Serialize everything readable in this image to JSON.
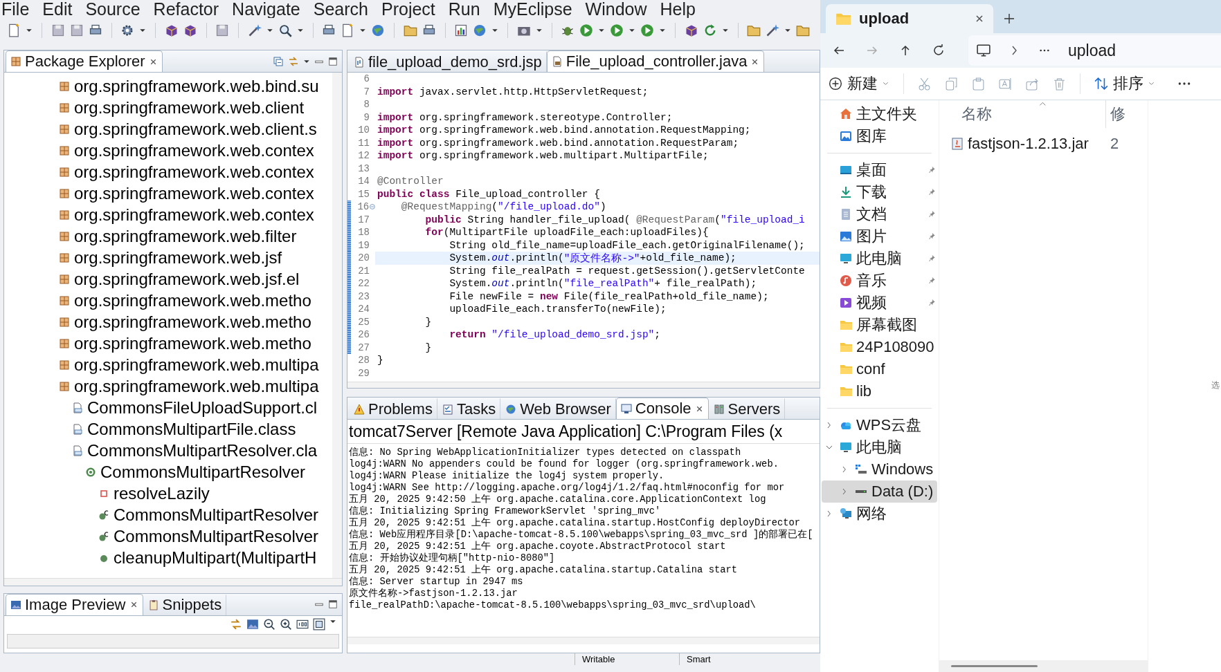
{
  "menu": [
    "File",
    "Edit",
    "Source",
    "Refactor",
    "Navigate",
    "Search",
    "Project",
    "Run",
    "MyEclipse",
    "Window",
    "Help"
  ],
  "package_explorer": {
    "tabs": [
      {
        "label": "Package Explorer",
        "selected": true
      }
    ],
    "tree": [
      {
        "label": "org.springframework.web.bind.su",
        "kind": "package"
      },
      {
        "label": "org.springframework.web.client",
        "kind": "package"
      },
      {
        "label": "org.springframework.web.client.s",
        "kind": "package"
      },
      {
        "label": "org.springframework.web.contex",
        "kind": "package"
      },
      {
        "label": "org.springframework.web.contex",
        "kind": "package"
      },
      {
        "label": "org.springframework.web.contex",
        "kind": "package"
      },
      {
        "label": "org.springframework.web.contex",
        "kind": "package"
      },
      {
        "label": "org.springframework.web.filter",
        "kind": "package"
      },
      {
        "label": "org.springframework.web.jsf",
        "kind": "package"
      },
      {
        "label": "org.springframework.web.jsf.el",
        "kind": "package"
      },
      {
        "label": "org.springframework.web.metho",
        "kind": "package"
      },
      {
        "label": "org.springframework.web.metho",
        "kind": "package"
      },
      {
        "label": "org.springframework.web.metho",
        "kind": "package"
      },
      {
        "label": "org.springframework.web.multipa",
        "kind": "package"
      },
      {
        "label": "org.springframework.web.multipa",
        "kind": "package",
        "children": [
          {
            "label": "CommonsFileUploadSupport.cl",
            "kind": "classfile"
          },
          {
            "label": "CommonsMultipartFile.class",
            "kind": "classfile"
          },
          {
            "label": "CommonsMultipartResolver.cla",
            "kind": "classfile",
            "children": [
              {
                "label": "CommonsMultipartResolver",
                "kind": "class",
                "children": [
                  {
                    "label": "resolveLazily",
                    "kind": "field"
                  },
                  {
                    "label": "CommonsMultipartResolver",
                    "kind": "constructor"
                  },
                  {
                    "label": "CommonsMultipartResolver",
                    "kind": "constructor"
                  },
                  {
                    "label": "cleanupMultipart(MultipartH",
                    "kind": "method"
                  }
                ]
              }
            ]
          }
        ]
      }
    ]
  },
  "editor": {
    "tabs": [
      {
        "label": "file_upload_demo_srd.jsp",
        "kind": "jsp",
        "selected": false
      },
      {
        "label": "File_upload_controller.java",
        "kind": "java",
        "selected": true
      }
    ],
    "lines": [
      {
        "number": "6",
        "highlighted": false,
        "changed": false,
        "collapsible": false
      },
      {
        "number": "7",
        "highlighted": false,
        "changed": false,
        "collapsible": false,
        "segments": [
          {
            "kind": "keyword",
            "text": "import"
          },
          {
            "kind": "plain",
            "text": " javax.servlet.http.HttpServletRequest;"
          }
        ]
      },
      {
        "number": "8",
        "highlighted": false,
        "changed": false,
        "collapsible": false
      },
      {
        "number": "9",
        "highlighted": false,
        "changed": false,
        "collapsible": false,
        "segments": [
          {
            "kind": "keyword",
            "text": "import"
          },
          {
            "kind": "plain",
            "text": " org.springframework.stereotype.Controller;"
          }
        ]
      },
      {
        "number": "10",
        "highlighted": false,
        "changed": false,
        "collapsible": false,
        "segments": [
          {
            "kind": "keyword",
            "text": "import"
          },
          {
            "kind": "plain",
            "text": " org.springframework.web.bind.annotation.RequestMapping;"
          }
        ]
      },
      {
        "number": "11",
        "highlighted": false,
        "changed": false,
        "collapsible": false,
        "segments": [
          {
            "kind": "keyword",
            "text": "import"
          },
          {
            "kind": "plain",
            "text": " org.springframework.web.bind.annotation.RequestParam;"
          }
        ]
      },
      {
        "number": "12",
        "highlighted": false,
        "changed": false,
        "collapsible": false,
        "segments": [
          {
            "kind": "keyword",
            "text": "import"
          },
          {
            "kind": "plain",
            "text": " org.springframework.web.multipart.MultipartFile;"
          }
        ]
      },
      {
        "number": "13",
        "highlighted": false,
        "changed": false,
        "collapsible": false
      },
      {
        "number": "14",
        "highlighted": false,
        "changed": false,
        "collapsible": false,
        "segments": [
          {
            "kind": "annotation",
            "text": "@Controller"
          }
        ]
      },
      {
        "number": "15",
        "highlighted": false,
        "changed": false,
        "collapsible": false,
        "segments": [
          {
            "kind": "keyword",
            "text": "public"
          },
          {
            "kind": "keyword",
            "text": " class"
          },
          {
            "kind": "plain",
            "text": " File_upload_controller {"
          }
        ]
      },
      {
        "number": "16",
        "highlighted": false,
        "changed": true,
        "collapsible": true,
        "segments": [
          {
            "kind": "annotation",
            "text": "    @RequestMapping"
          },
          {
            "kind": "plain",
            "text": "("
          },
          {
            "kind": "string",
            "text": "\"/file_upload.do\""
          },
          {
            "kind": "plain",
            "text": ")"
          }
        ]
      },
      {
        "number": "17",
        "highlighted": false,
        "changed": true,
        "collapsible": false,
        "segments": [
          {
            "kind": "keyword",
            "text": "        public"
          },
          {
            "kind": "plain",
            "text": " String handler_file_upload( "
          },
          {
            "kind": "annotation",
            "text": "@RequestParam"
          },
          {
            "kind": "plain",
            "text": "("
          },
          {
            "kind": "string",
            "text": "\"file_upload_i"
          }
        ]
      },
      {
        "number": "18",
        "highlighted": false,
        "changed": true,
        "collapsible": false,
        "segments": [
          {
            "kind": "keyword",
            "text": "        for"
          },
          {
            "kind": "plain",
            "text": "(MultipartFile uploadFile_each:uploadFiles){"
          }
        ]
      },
      {
        "number": "19",
        "highlighted": false,
        "changed": true,
        "collapsible": false,
        "segments": [
          {
            "kind": "plain",
            "text": "            String old_file_name=uploadFile_each.getOriginalFilename();"
          }
        ]
      },
      {
        "number": "20",
        "highlighted": true,
        "changed": true,
        "collapsible": false,
        "segments": [
          {
            "kind": "plain",
            "text": "            System."
          },
          {
            "kind": "static_field",
            "text": "out"
          },
          {
            "kind": "plain",
            "text": ".println("
          },
          {
            "kind": "string",
            "text": "\"原文件名称->\""
          },
          {
            "kind": "plain",
            "text": "+old_file_name);"
          }
        ]
      },
      {
        "number": "21",
        "highlighted": false,
        "changed": true,
        "collapsible": false,
        "segments": [
          {
            "kind": "plain",
            "text": "            String file_realPath = request.getSession().getServletConte"
          }
        ]
      },
      {
        "number": "22",
        "highlighted": false,
        "changed": true,
        "collapsible": false,
        "segments": [
          {
            "kind": "plain",
            "text": "            System."
          },
          {
            "kind": "static_field",
            "text": "out"
          },
          {
            "kind": "plain",
            "text": ".println("
          },
          {
            "kind": "string",
            "text": "\"file_realPath\""
          },
          {
            "kind": "plain",
            "text": "+ file_realPath);"
          }
        ]
      },
      {
        "number": "23",
        "highlighted": false,
        "changed": true,
        "collapsible": false,
        "segments": [
          {
            "kind": "plain",
            "text": "            File newFile = "
          },
          {
            "kind": "keyword",
            "text": "new"
          },
          {
            "kind": "plain",
            "text": " File(file_realPath+old_file_name);"
          }
        ]
      },
      {
        "number": "24",
        "highlighted": false,
        "changed": true,
        "collapsible": false,
        "segments": [
          {
            "kind": "plain",
            "text": "            uploadFile_each.transferTo(newFile);"
          }
        ]
      },
      {
        "number": "25",
        "highlighted": false,
        "changed": true,
        "collapsible": false,
        "segments": [
          {
            "kind": "plain",
            "text": "        }"
          }
        ]
      },
      {
        "number": "26",
        "highlighted": false,
        "changed": true,
        "collapsible": false,
        "segments": [
          {
            "kind": "keyword",
            "text": "            return"
          },
          {
            "kind": "string",
            "text": " \"/file_upload_demo_srd.jsp\""
          },
          {
            "kind": "plain",
            "text": ";"
          }
        ]
      },
      {
        "number": "27",
        "highlighted": false,
        "changed": true,
        "collapsible": false,
        "segments": [
          {
            "kind": "plain",
            "text": "        }"
          }
        ]
      },
      {
        "number": "28",
        "highlighted": false,
        "changed": false,
        "collapsible": false,
        "segments": [
          {
            "kind": "plain",
            "text": "}"
          }
        ]
      },
      {
        "number": "29",
        "highlighted": false,
        "changed": false,
        "collapsible": false
      }
    ]
  },
  "bottom_panel": {
    "tabs": [
      {
        "label": "Problems",
        "kind": "problems",
        "selected": false
      },
      {
        "label": "Tasks",
        "kind": "tasks",
        "selected": false
      },
      {
        "label": "Web Browser",
        "kind": "browser",
        "selected": false
      },
      {
        "label": "Console",
        "kind": "console",
        "selected": true
      },
      {
        "label": "Servers",
        "kind": "servers",
        "selected": false
      }
    ],
    "console_title": "tomcat7Server [Remote Java Application] C:\\Program Files (x",
    "console_lines": [
      "信息: No Spring WebApplicationInitializer types detected on classpath",
      "log4j:WARN No appenders could be found for logger (org.springframework.web.",
      "log4j:WARN Please initialize the log4j system properly.",
      "log4j:WARN See http://logging.apache.org/log4j/1.2/faq.html#noconfig for mor",
      "五月 20, 2025 9:42:50 上午 org.apache.catalina.core.ApplicationContext log",
      "信息: Initializing Spring FrameworkServlet 'spring_mvc'",
      "五月 20, 2025 9:42:51 上午 org.apache.catalina.startup.HostConfig deployDirector",
      "信息: Web应用程序目录[D:\\apache-tomcat-8.5.100\\webapps\\spring_03_mvc_srd ]的部署已在[",
      "五月 20, 2025 9:42:51 上午 org.apache.coyote.AbstractProtocol start",
      "信息: 开始协议处理句柄[\"http-nio-8080\"]",
      "五月 20, 2025 9:42:51 上午 org.apache.catalina.startup.Catalina start",
      "信息: Server startup in 2947 ms",
      "原文件名称->fastjson-1.2.13.jar",
      "file_realPathD:\\apache-tomcat-8.5.100\\webapps\\spring_03_mvc_srd\\upload\\"
    ]
  },
  "preview_panel": {
    "tabs": [
      {
        "label": "Image Preview",
        "kind": "image",
        "selected": true
      },
      {
        "label": "Snippets",
        "kind": "snippets",
        "selected": false
      }
    ]
  },
  "status_bar": [
    "Writable",
    "Smart"
  ],
  "file_explorer": {
    "tabs": [
      {
        "label": "upload",
        "selected": true
      }
    ],
    "address": "upload",
    "commands": [
      {
        "label": "新建",
        "kind": "new"
      },
      {
        "label": "排序",
        "kind": "sort"
      }
    ],
    "home_items": [
      {
        "label": "主文件夹",
        "kind": "home"
      },
      {
        "label": "图库",
        "kind": "gallery"
      }
    ],
    "quick_access": [
      {
        "label": "桌面",
        "kind": "desktop",
        "pinned": true
      },
      {
        "label": "下载",
        "kind": "download",
        "pinned": true
      },
      {
        "label": "文档",
        "kind": "document",
        "pinned": true
      },
      {
        "label": "图片",
        "kind": "pictures",
        "pinned": true
      },
      {
        "label": "此电脑",
        "kind": "pc",
        "pinned": true
      },
      {
        "label": "音乐",
        "kind": "music",
        "pinned": true
      },
      {
        "label": "视频",
        "kind": "video",
        "pinned": true
      },
      {
        "label": "屏幕截图",
        "kind": "folder",
        "pinned": false
      },
      {
        "label": "24P108090",
        "kind": "folder",
        "pinned": false
      },
      {
        "label": "conf",
        "kind": "folder",
        "pinned": false
      },
      {
        "label": "lib",
        "kind": "folder",
        "pinned": false
      }
    ],
    "tree": [
      {
        "label": "WPS云盘",
        "kind": "cloud",
        "expanded": false,
        "selected": false
      },
      {
        "label": "此电脑",
        "kind": "pc",
        "expanded": true,
        "selected": false,
        "children": [
          {
            "label": "Windows",
            "kind": "system_drive",
            "expanded": false,
            "selected": false
          },
          {
            "label": "Data (D:)",
            "kind": "drive",
            "expanded": false,
            "selected": true
          }
        ]
      },
      {
        "label": "网络",
        "kind": "network",
        "expanded": false,
        "selected": false
      }
    ],
    "columns": [
      "名称",
      "修"
    ],
    "files": [
      {
        "name": "fastjson-1.2.13.jar",
        "column_2": "2"
      }
    ],
    "details_hint": "选"
  }
}
